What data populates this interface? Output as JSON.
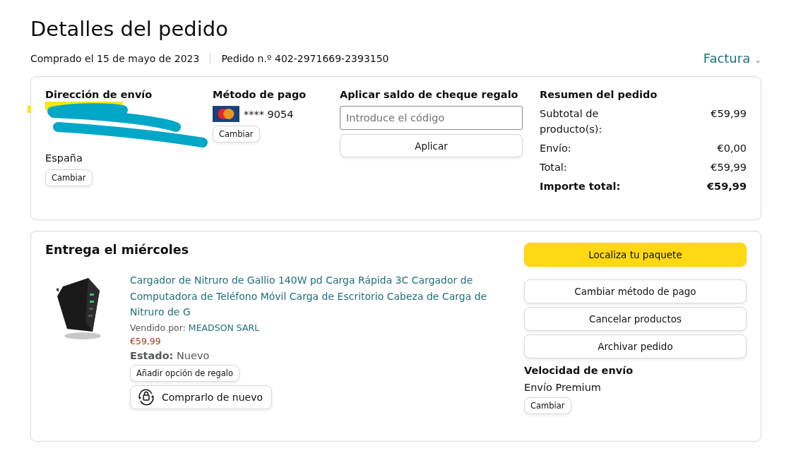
{
  "page": {
    "title": "Detalles del pedido",
    "purchase_date": "Comprado el 15 de mayo de 2023",
    "order_number": "Pedido n.º 402-2971669-2393150",
    "invoice_link": "Factura",
    "invoice_caret": "⌄"
  },
  "summary_card": {
    "shipping_address": {
      "heading": "Dirección de envío",
      "lines": [
        "España"
      ],
      "change_button": "Cambiar"
    },
    "payment_method": {
      "heading": "Método de pago",
      "card_number": "**** 9054",
      "change_button": "Cambiar"
    },
    "gift_card": {
      "heading": "Aplicar saldo de cheque regalo",
      "placeholder": "Introduce el código",
      "apply_button": "Aplicar"
    },
    "order_summary": {
      "heading": "Resumen del pedido",
      "rows": [
        {
          "label": "Subtotal de producto(s):",
          "value": "€59,99",
          "bold": false
        },
        {
          "label": "Envío:",
          "value": "€0,00",
          "bold": false
        },
        {
          "label": "Total:",
          "value": "€59,99",
          "bold": false
        },
        {
          "label": "Importe total:",
          "value": "€59,99",
          "bold": true
        }
      ]
    }
  },
  "delivery_card": {
    "heading": "Entrega el miércoles",
    "product": {
      "title": "Cargador de Nitruro de Gallio 140W pd Carga Rápida 3C Cargador de Computadora de Teléfono Móvil Carga de Escritorio Cabeza de Carga de Nitruro de G",
      "seller_label": "Vendido por:",
      "seller": "MEADSON SARL",
      "price": "€59,99",
      "condition_label": "Estado:",
      "condition": "Nuevo",
      "gift_button": "Añadir opción de regalo",
      "buy_again_button": "Comprarlo de nuevo"
    },
    "actions": [
      {
        "label": "Localiza tu paquete",
        "primary": true
      },
      {
        "label": "Cambiar método de pago",
        "primary": false
      },
      {
        "label": "Cancelar productos",
        "primary": false
      },
      {
        "label": "Archivar pedido",
        "primary": false
      }
    ],
    "shipping_speed": {
      "heading": "Velocidad de envío",
      "value": "Envío Premium",
      "change_button": "Cambiar"
    }
  }
}
